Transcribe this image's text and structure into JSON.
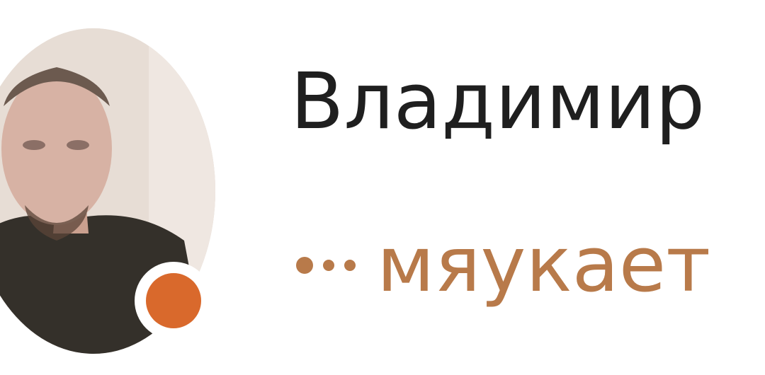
{
  "contact": {
    "name": "Владимир",
    "status": "мяукает",
    "online": true
  },
  "colors": {
    "name_text": "#1f1f1f",
    "status_text": "#b87a4a",
    "online_indicator": "#d9692c",
    "background": "#ffffff"
  },
  "icons": {
    "typing": "typing-dots-icon",
    "presence": "online-dot-icon"
  }
}
